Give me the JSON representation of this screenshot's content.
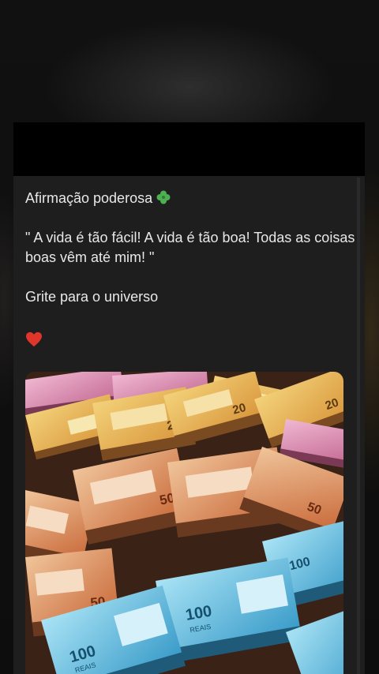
{
  "post": {
    "title": "Afirmação poderosa",
    "title_emoji": "clover-icon",
    "quote": "\" A vida é tão fácil! A vida é tão boa! Todas as coisas boas vêm até mim! \"",
    "call_to_action": "Grite para o universo",
    "reaction_emoji": "heart-icon"
  },
  "image": {
    "subject": "stacks of Brazilian real banknotes",
    "denominations": [
      "20",
      "50",
      "100"
    ],
    "bill_label": "REAIS"
  },
  "colors": {
    "card": "#1e1e1e",
    "text": "#e8e8e8",
    "heart": "#e0352b",
    "clover": "#4caf50",
    "note_20": "#e9b64a",
    "note_50": "#e07a4a",
    "note_100": "#4fb3d9"
  }
}
